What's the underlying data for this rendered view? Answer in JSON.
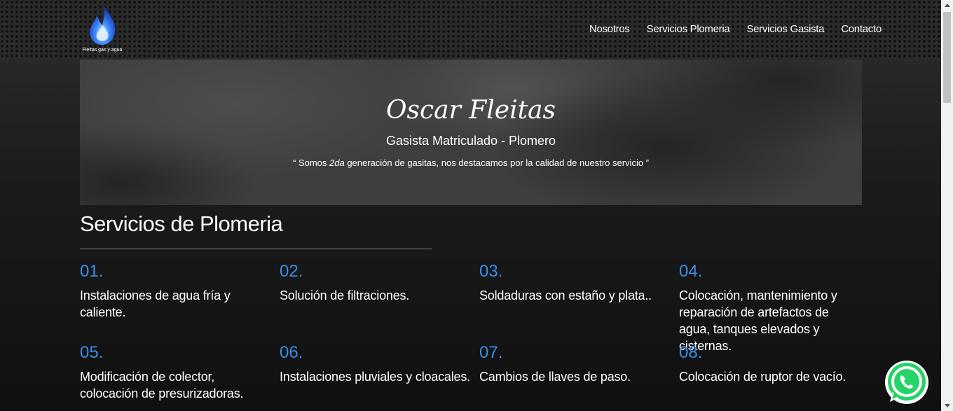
{
  "header": {
    "logo_text": "Fleitas gas y agua",
    "nav": [
      "Nosotros",
      "Servicios Plomeria",
      "Servicios Gasista",
      "Contacto"
    ]
  },
  "hero": {
    "title": "Oscar Fleitas",
    "subtitle": "Gasista Matriculado - Plomero",
    "quote_prefix": "“ Somos ",
    "quote_em": "2da",
    "quote_suffix": " generación de gasitas, nos destacamos por la calidad de nuestro servicio ”"
  },
  "section": {
    "title": "Servicios de Plomeria",
    "services": [
      {
        "num": "01.",
        "text": "Instalaciones de agua fría y caliente."
      },
      {
        "num": "02.",
        "text": "Solución de filtraciones."
      },
      {
        "num": "03.",
        "text": "Soldaduras con estaño y plata.."
      },
      {
        "num": "04.",
        "text": "Colocación, mantenimiento y reparación de artefactos de agua, tanques elevados y cisternas."
      },
      {
        "num": "05.",
        "text": "Modificación de colector, colocación de presurizadoras."
      },
      {
        "num": "06.",
        "text": "Instalaciones pluviales y cloacales."
      },
      {
        "num": "07.",
        "text": "Cambios de llaves de paso."
      },
      {
        "num": "08.",
        "text": "Colocación de ruptor de vacío."
      }
    ]
  },
  "colors": {
    "accent": "#3a8ee8",
    "whatsapp": "#25d366"
  },
  "icons": {
    "logo": "flame-icon",
    "floating": "whatsapp-icon"
  }
}
